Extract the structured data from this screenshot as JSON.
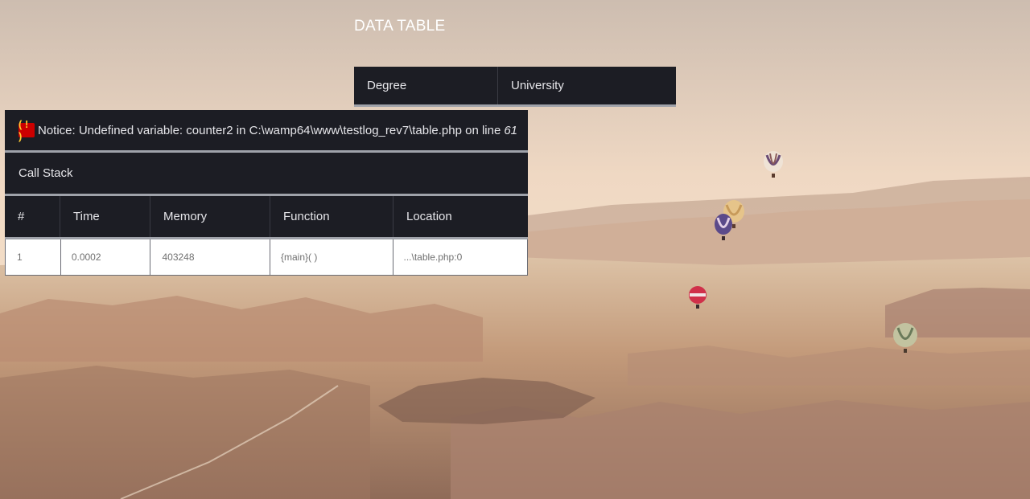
{
  "page": {
    "title": "DATA TABLE"
  },
  "data_table": {
    "columns": [
      "Degree",
      "University"
    ]
  },
  "xdebug": {
    "notice_badge": "( ! )",
    "notice_text": "Notice: Undefined variable: counter2 in C:\\wamp64\\www\\testlog_rev7\\table.php on line",
    "notice_line": "61",
    "call_stack_label": "Call Stack",
    "headers": [
      "#",
      "Time",
      "Memory",
      "Function",
      "Location"
    ],
    "rows": [
      {
        "num": "1",
        "time": "0.0002",
        "memory": "403248",
        "function": "{main}( )",
        "location": "...\\table.php:0"
      }
    ]
  },
  "colors": {
    "panel_dark": "#1c1d24",
    "panel_border": "#9fa2aa",
    "badge_red": "#cc0000",
    "badge_text": "#ffcc33"
  }
}
